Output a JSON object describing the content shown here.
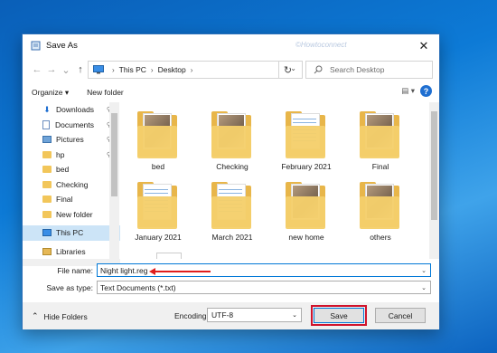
{
  "dialog": {
    "title": "Save As",
    "watermark": "©Howtoconnect",
    "close_icon": "✕"
  },
  "nav": {
    "back": "←",
    "forward": "→",
    "recent": "⌄",
    "up": "↑",
    "crumbs": [
      "This PC",
      "Desktop"
    ],
    "refresh": "↻",
    "search_placeholder": "Search Desktop"
  },
  "toolbar": {
    "organize": "Organize ▾",
    "new_folder": "New folder",
    "view": "▤ ▾",
    "help": "?"
  },
  "sidebar": {
    "items": [
      {
        "label": "Downloads",
        "icon": "download-icon",
        "pinned": true
      },
      {
        "label": "Documents",
        "icon": "documents-icon",
        "pinned": true
      },
      {
        "label": "Pictures",
        "icon": "pictures-icon",
        "pinned": true
      },
      {
        "label": "hp",
        "icon": "folder-icon",
        "pinned": true
      },
      {
        "label": "bed",
        "icon": "folder-icon",
        "pinned": false
      },
      {
        "label": "Checking",
        "icon": "folder-icon",
        "pinned": false
      },
      {
        "label": "Final",
        "icon": "folder-icon",
        "pinned": false
      },
      {
        "label": "New folder",
        "icon": "folder-icon",
        "pinned": false
      },
      {
        "label": "This PC",
        "icon": "pc-icon",
        "pinned": false
      },
      {
        "label": "Libraries",
        "icon": "libraries-icon",
        "pinned": false
      }
    ],
    "pin_glyph": "📌"
  },
  "files": [
    {
      "name": "bed",
      "style": "photo"
    },
    {
      "name": "Checking",
      "style": "photo"
    },
    {
      "name": "February 2021",
      "style": "doc"
    },
    {
      "name": "Final",
      "style": "photo"
    },
    {
      "name": "January 2021",
      "style": "doc"
    },
    {
      "name": "March 2021",
      "style": "doc"
    },
    {
      "name": "new home",
      "style": "photo"
    },
    {
      "name": "others",
      "style": "photo"
    }
  ],
  "form": {
    "file_name_label": "File name:",
    "file_name_value": "Night light.reg",
    "save_as_type_label": "Save as type:",
    "save_as_type_value": "Text Documents (*.txt)"
  },
  "footer": {
    "hide_folders": "Hide Folders",
    "hide_glyph": "⌃",
    "encoding_label": "Encoding:",
    "encoding_value": "UTF-8",
    "save": "Save",
    "cancel": "Cancel"
  },
  "colors": {
    "accent": "#0078d7",
    "annotation": "#e01e1e",
    "folder": "#f2c65a"
  }
}
